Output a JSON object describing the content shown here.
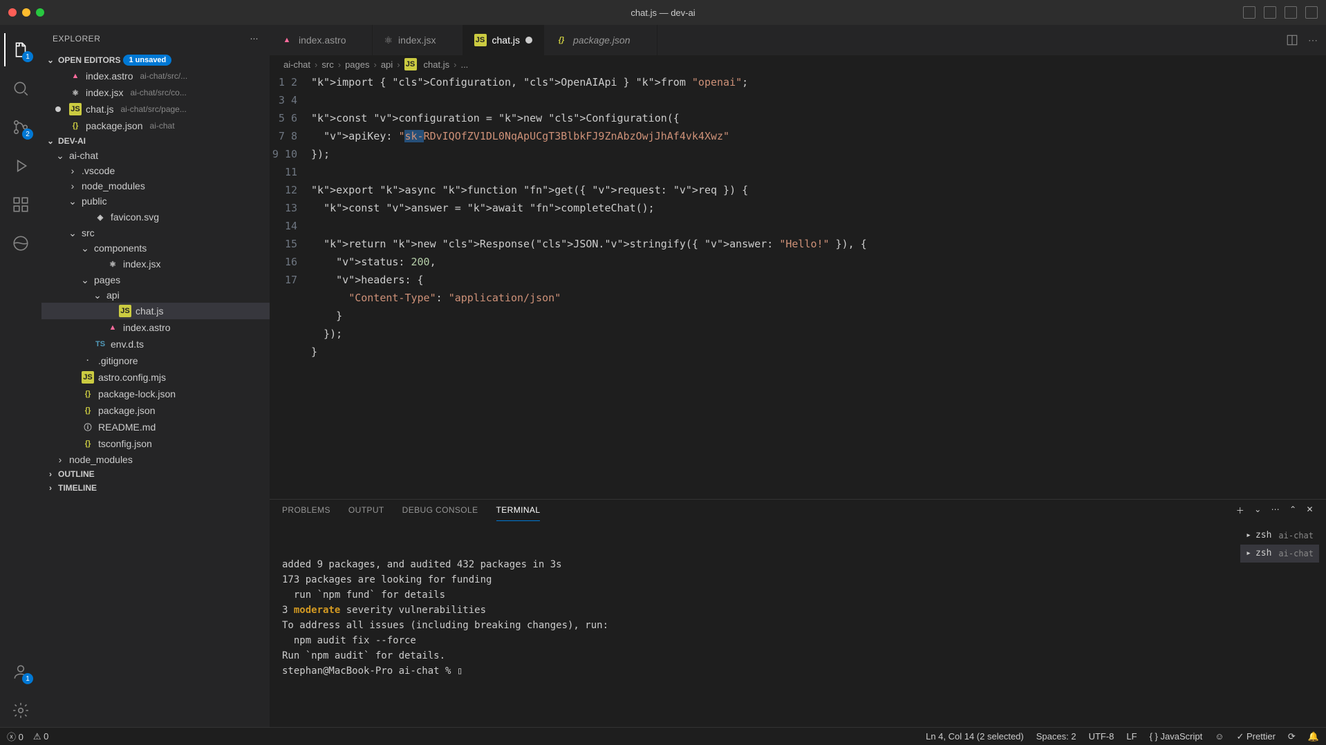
{
  "window": {
    "title": "chat.js — dev-ai"
  },
  "activity_badges": {
    "explorer": "1",
    "scm": "2",
    "account": "1"
  },
  "explorer": {
    "title": "EXPLORER",
    "open_editors_label": "OPEN EDITORS",
    "unsaved_label": "1 unsaved",
    "open_editors": [
      {
        "name": "index.astro",
        "path": "ai-chat/src/..."
      },
      {
        "name": "index.jsx",
        "path": "ai-chat/src/co..."
      },
      {
        "name": "chat.js",
        "path": "ai-chat/src/page...",
        "modified": true
      },
      {
        "name": "package.json",
        "path": "ai-chat"
      }
    ],
    "project": "DEV-AI",
    "tree": {
      "root": "ai-chat",
      "items": [
        {
          "name": ".vscode",
          "type": "folder",
          "depth": 1
        },
        {
          "name": "node_modules",
          "type": "folder",
          "depth": 1
        },
        {
          "name": "public",
          "type": "folder",
          "depth": 1,
          "open": true
        },
        {
          "name": "favicon.svg",
          "type": "file",
          "depth": 2
        },
        {
          "name": "src",
          "type": "folder",
          "depth": 1,
          "open": true
        },
        {
          "name": "components",
          "type": "folder",
          "depth": 2,
          "open": true
        },
        {
          "name": "index.jsx",
          "type": "file",
          "depth": 3
        },
        {
          "name": "pages",
          "type": "folder",
          "depth": 2,
          "open": true
        },
        {
          "name": "api",
          "type": "folder",
          "depth": 3,
          "open": true
        },
        {
          "name": "chat.js",
          "type": "file",
          "depth": 4,
          "selected": true
        },
        {
          "name": "index.astro",
          "type": "file",
          "depth": 3
        },
        {
          "name": "env.d.ts",
          "type": "file",
          "depth": 2
        },
        {
          "name": ".gitignore",
          "type": "file",
          "depth": 1
        },
        {
          "name": "astro.config.mjs",
          "type": "file",
          "depth": 1
        },
        {
          "name": "package-lock.json",
          "type": "file",
          "depth": 1
        },
        {
          "name": "package.json",
          "type": "file",
          "depth": 1
        },
        {
          "name": "README.md",
          "type": "file",
          "depth": 1
        },
        {
          "name": "tsconfig.json",
          "type": "file",
          "depth": 1
        },
        {
          "name": "node_modules",
          "type": "folder",
          "depth": 0
        }
      ]
    },
    "outline": "OUTLINE",
    "timeline": "TIMELINE"
  },
  "tabs": [
    {
      "label": "index.astro",
      "icon": "astro"
    },
    {
      "label": "index.jsx",
      "icon": "react"
    },
    {
      "label": "chat.js",
      "icon": "js",
      "active": true,
      "modified": true
    },
    {
      "label": "package.json",
      "icon": "json",
      "preview": true
    }
  ],
  "breadcrumb": [
    "ai-chat",
    "src",
    "pages",
    "api",
    "chat.js",
    "..."
  ],
  "code_lines": [
    "import { Configuration, OpenAIApi } from \"openai\";",
    "",
    "const configuration = new Configuration({",
    "  apiKey: \"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\"",
    "});",
    "",
    "export async function get({ request: req }) {",
    "  const answer = await completeChat();",
    "",
    "  return new Response(JSON.stringify({ answer: \"Hello!\" }), {",
    "    status: 200,",
    "    headers: {",
    "      \"Content-Type\": \"application/json\"",
    "    }",
    "  });",
    "}",
    ""
  ],
  "panel": {
    "tabs": [
      "PROBLEMS",
      "OUTPUT",
      "DEBUG CONSOLE",
      "TERMINAL"
    ],
    "active": "TERMINAL",
    "sessions": [
      {
        "shell": "zsh",
        "label": "ai-chat"
      },
      {
        "shell": "zsh",
        "label": "ai-chat",
        "active": true
      }
    ],
    "lines": [
      "added 9 packages, and audited 432 packages in 3s",
      "",
      "173 packages are looking for funding",
      "  run `npm fund` for details",
      "",
      "3 moderate severity vulnerabilities",
      "",
      "To address all issues (including breaking changes), run:",
      "  npm audit fix --force",
      "",
      "Run `npm audit` for details.",
      "stephan@MacBook-Pro ai-chat % ▯"
    ]
  },
  "status": {
    "errors": "0",
    "warnings": "0",
    "cursor": "Ln 4, Col 14 (2 selected)",
    "spaces": "Spaces: 2",
    "encoding": "UTF-8",
    "eol": "LF",
    "lang": "JavaScript",
    "prettier": "Prettier"
  }
}
